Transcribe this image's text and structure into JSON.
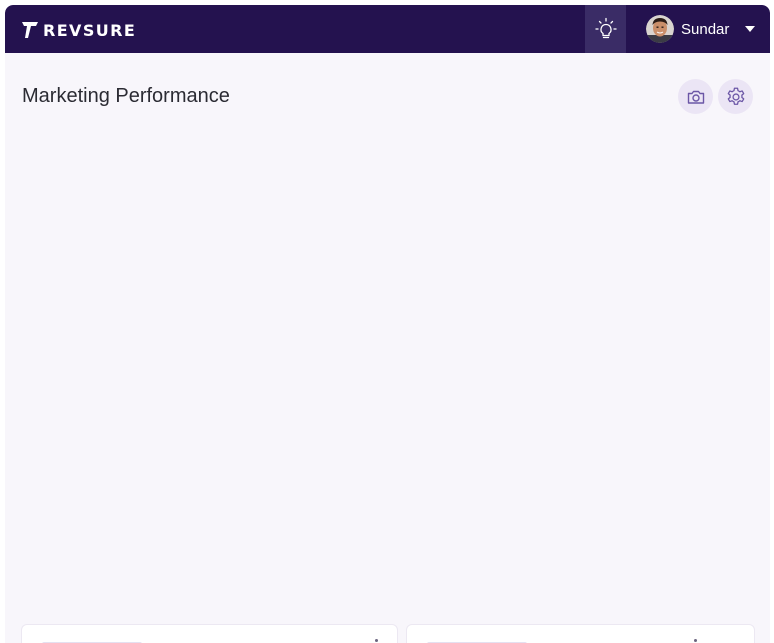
{
  "header": {
    "logo_text": "REVSURE",
    "user": {
      "name": "Sundar"
    }
  },
  "main": {
    "title": "Marketing Performance"
  },
  "icons": {
    "logo": "revsure-logo-icon",
    "idea": "lightbulb-icon",
    "avatar": "user-avatar",
    "dropdown": "caret-down-icon",
    "camera": "camera-icon",
    "settings": "gear-icon"
  },
  "colors": {
    "topbar": "#24124f",
    "idea_button": "#3a2c66",
    "page_background": "#f8f6fb",
    "round_button": "#ebe5f5",
    "icon_accent": "#6b56a6"
  }
}
